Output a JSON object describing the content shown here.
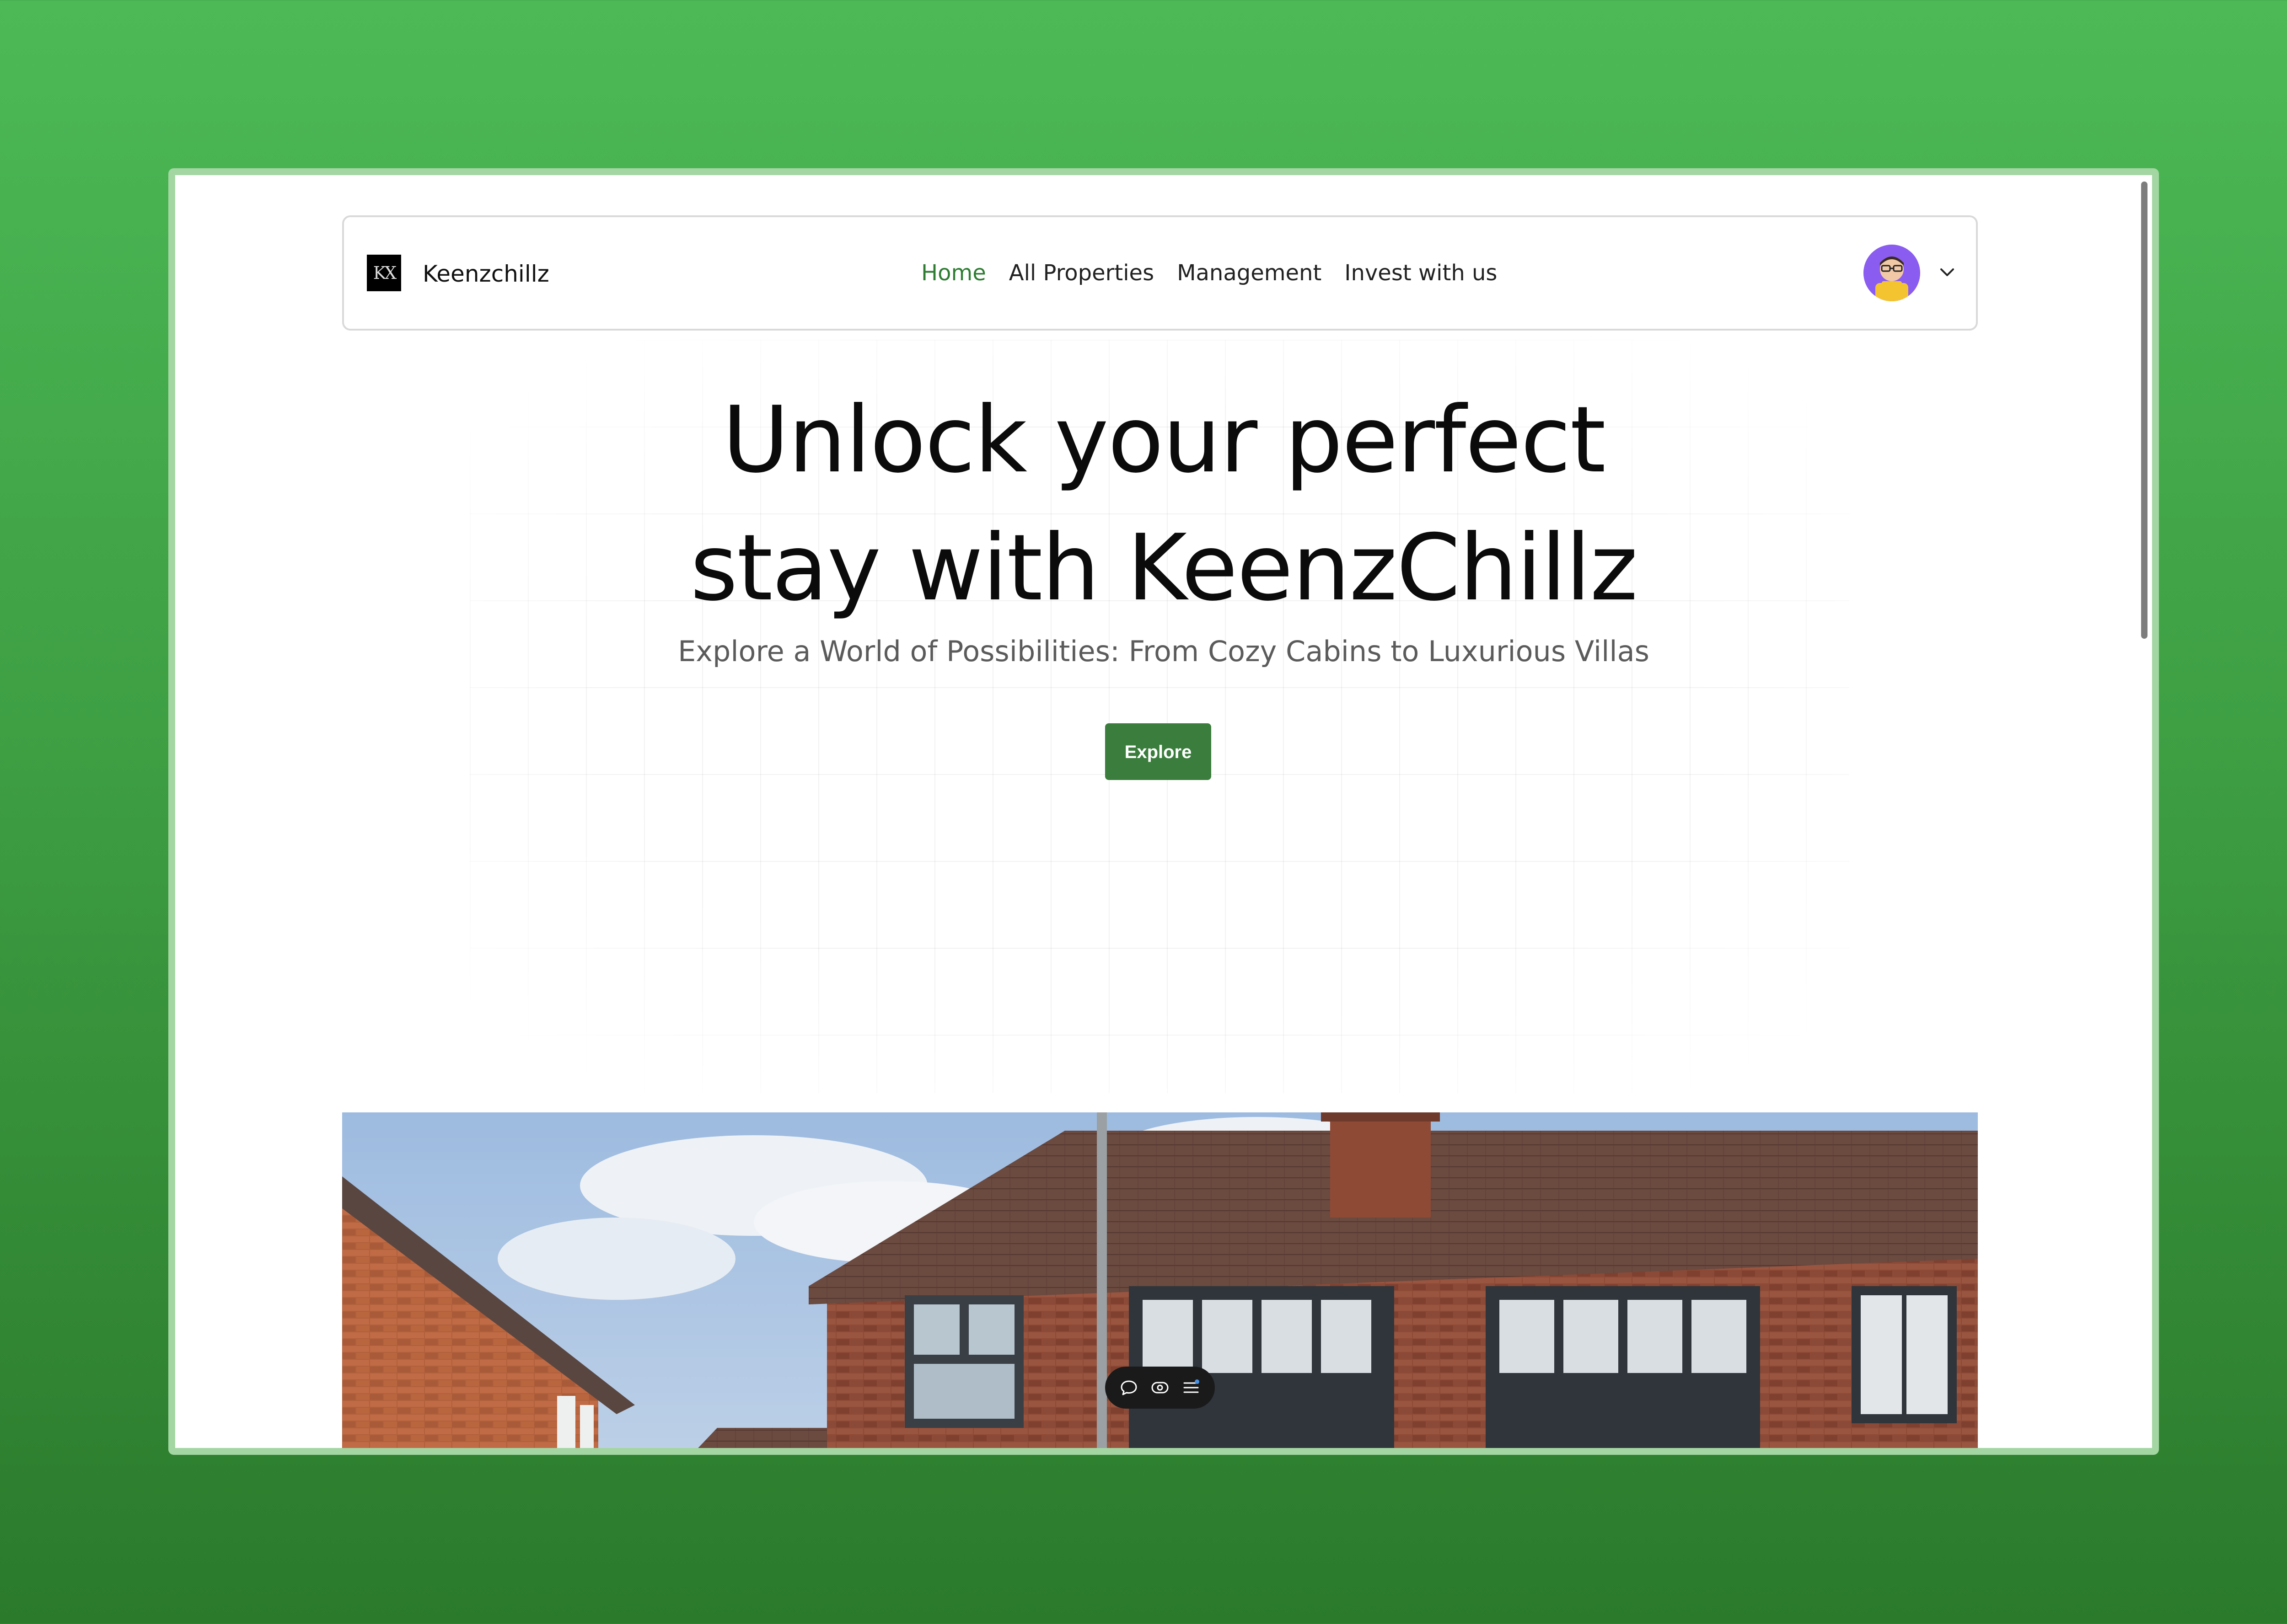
{
  "brand": {
    "logo_text": "KX",
    "name": "Keenzchillz"
  },
  "nav": {
    "links": [
      {
        "label": "Home",
        "active": true
      },
      {
        "label": "All Properties",
        "active": false
      },
      {
        "label": "Management",
        "active": false
      },
      {
        "label": "Invest with us",
        "active": false
      }
    ]
  },
  "user_menu": {
    "avatar_icon": "user-avatar",
    "dropdown_icon": "chevron-down-icon"
  },
  "hero": {
    "headline_line1": "Unlock your perfect",
    "headline_line2": "stay with KeenzChillz",
    "subheadline": "Explore a World of Possibilities: From Cozy Cabins to Luxurious Villas",
    "cta_label": "Explore"
  },
  "toolbar": {
    "icons": [
      "comment-icon",
      "eye-icon",
      "menu-list-icon"
    ]
  },
  "colors": {
    "background_green": "#4cb956",
    "accent": "#2e7d32",
    "button": "#3a7d3c",
    "window_border": "#a3d6a2"
  }
}
